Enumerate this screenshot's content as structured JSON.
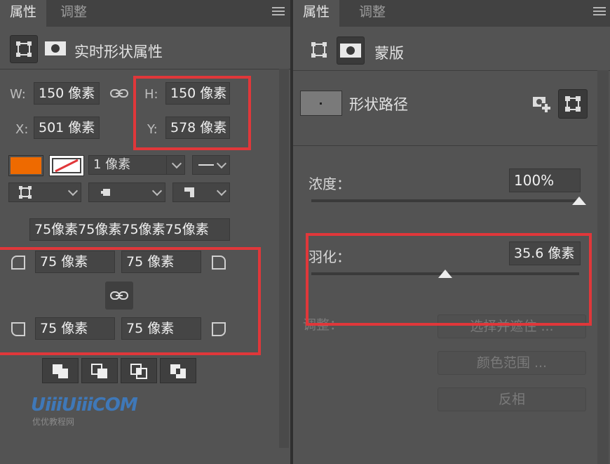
{
  "left": {
    "tabs": [
      "属性",
      "调整"
    ],
    "header_label": "实时形状属性",
    "w_label": "W:",
    "w_value": "150 像素",
    "h_label": "H:",
    "h_value": "150 像素",
    "x_label": "X:",
    "x_value": "501 像素",
    "y_label": "Y:",
    "y_value": "578 像素",
    "stroke_width": "1 像素",
    "corner_radii_summary": "75像素75像素75像素75像素",
    "corner_tl": "75 像素",
    "corner_tr": "75 像素",
    "corner_bl": "75 像素",
    "corner_br": "75 像素",
    "fill_color": "#ee6a00",
    "watermark_logo": "UiiiUiiiCOM",
    "watermark_text": "优优教程网"
  },
  "right": {
    "tabs": [
      "属性",
      "调整"
    ],
    "header_label": "蒙版",
    "mask_name": "形状路径",
    "density_label": "浓度：",
    "density_value": "100%",
    "density_percent": 100,
    "feather_label": "羽化：",
    "feather_value": "35.6 像素",
    "feather_fraction": 0.5,
    "adjust_label": "调整：",
    "btn_select_mask": "选择并遮住 ...",
    "btn_color_range": "颜色范围 ...",
    "btn_invert": "反相"
  },
  "colors": {
    "highlight": "#e0373a",
    "panel_bg": "#535353",
    "accent_fill": "#ee6a00"
  }
}
